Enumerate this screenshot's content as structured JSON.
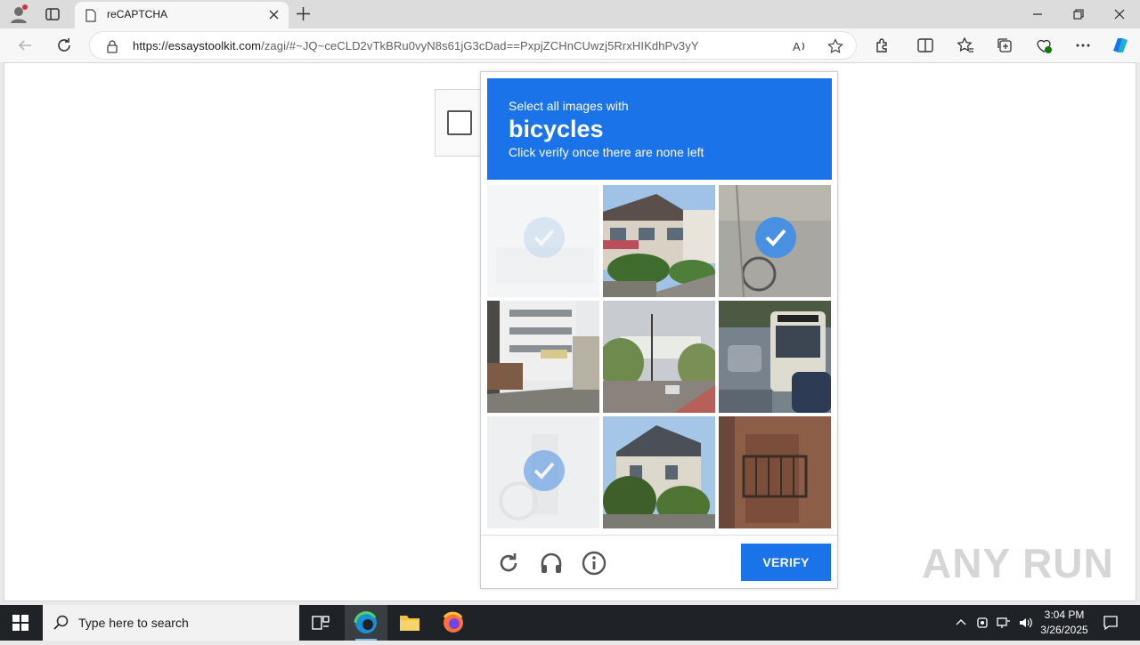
{
  "browser": {
    "tab_title": "reCAPTCHA",
    "url_host": "https://essaystoolkit.com",
    "url_path": "/zagi/#~JQ~ceCLD2vTkBRu0vyN8s61jG3cDad==PxpjZCHnCUwzj5RrxHIKdhPv3yY"
  },
  "captcha": {
    "prompt_line1": "Select all images with",
    "prompt_target": "bicycles",
    "prompt_line3": "Click verify once there are none left",
    "verify_label": "VERIFY",
    "tiles": [
      {
        "name": "tile-1",
        "scene": "faded-selected",
        "selected": true
      },
      {
        "name": "tile-2",
        "scene": "row-houses",
        "selected": false
      },
      {
        "name": "tile-3",
        "scene": "bicycle-street",
        "selected": true
      },
      {
        "name": "tile-4",
        "scene": "apartment-building",
        "selected": false
      },
      {
        "name": "tile-5",
        "scene": "street-intersection",
        "selected": false
      },
      {
        "name": "tile-6",
        "scene": "bus-traffic",
        "selected": false
      },
      {
        "name": "tile-7",
        "scene": "faded-selected",
        "selected": true
      },
      {
        "name": "tile-8",
        "scene": "house-trees",
        "selected": false
      },
      {
        "name": "tile-9",
        "scene": "balcony",
        "selected": false
      }
    ],
    "footer_icons": [
      "reload-icon",
      "headphones-icon",
      "info-icon"
    ]
  },
  "watermark": "ANY RUN",
  "taskbar": {
    "search_placeholder": "Type here to search",
    "time": "3:04 PM",
    "date": "3/26/2025"
  },
  "colors": {
    "accent": "#1a73e8",
    "check": "#4a90e2",
    "taskbar": "#1f2226"
  }
}
